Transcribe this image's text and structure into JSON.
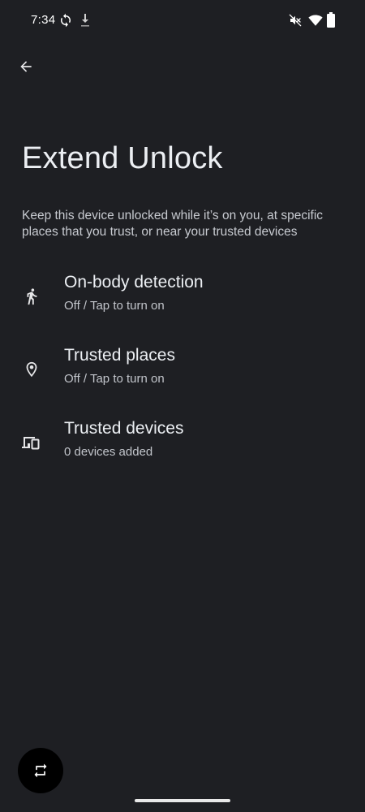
{
  "status_bar": {
    "time": "7:34",
    "icons": [
      "sync-icon",
      "download-icon",
      "mute-icon",
      "wifi-icon",
      "battery-icon"
    ]
  },
  "toolbar": {
    "back_icon": "arrow-back-icon"
  },
  "page": {
    "title": "Extend Unlock",
    "description": "Keep this device unlocked while it’s on you, at specific places that you trust, or near your trusted devices"
  },
  "settings": [
    {
      "icon": "walking-person-icon",
      "title": "On-body detection",
      "subtitle": "Off / Tap to turn on"
    },
    {
      "icon": "location-pin-icon",
      "title": "Trusted places",
      "subtitle": "Off / Tap to turn on"
    },
    {
      "icon": "devices-icon",
      "title": "Trusted devices",
      "subtitle": "0 devices added"
    }
  ],
  "fab": {
    "icon": "rotate-screen-icon"
  },
  "colors": {
    "background": "#1e1f23",
    "text_primary": "#eceff3",
    "text_secondary": "#c2c5cb",
    "fab_background": "#000000"
  }
}
